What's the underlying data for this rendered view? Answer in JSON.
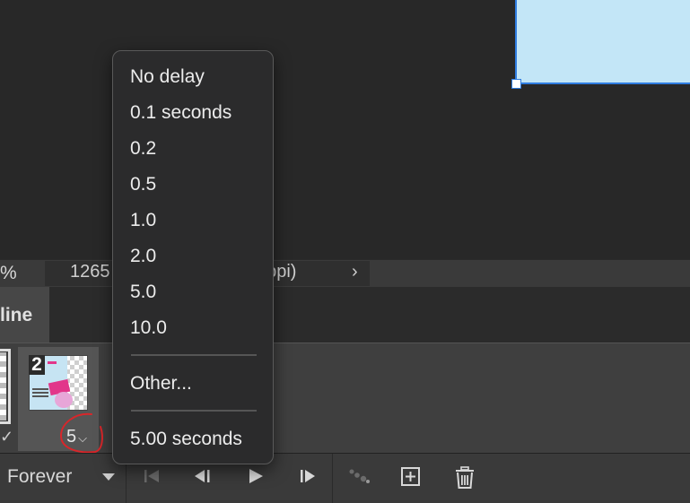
{
  "status": {
    "zoom": "%",
    "info": "1265",
    "info_tail": ": ppi)",
    "arrow": "›"
  },
  "tabs": {
    "timeline_label": "line"
  },
  "frames": {
    "partial_delay": "✓",
    "frame2_number": "2",
    "frame2_delay": "5"
  },
  "toolbar": {
    "loop_label": "Forever"
  },
  "delay_menu": {
    "items": [
      "No delay",
      "0.1 seconds",
      "0.2",
      "0.5",
      "1.0",
      "2.0",
      "5.0",
      "10.0"
    ],
    "other": "Other...",
    "current": "5.00 seconds"
  },
  "colors": {
    "selection_border": "#2f7de1",
    "document_fill": "#c3e6f7",
    "annotation_red": "#d9262a"
  },
  "icons": [
    "first-frame-icon",
    "previous-frame-icon",
    "play-icon",
    "next-frame-icon",
    "tween-icon",
    "duplicate-frame-icon",
    "delete-icon",
    "chevron-down-icon"
  ]
}
